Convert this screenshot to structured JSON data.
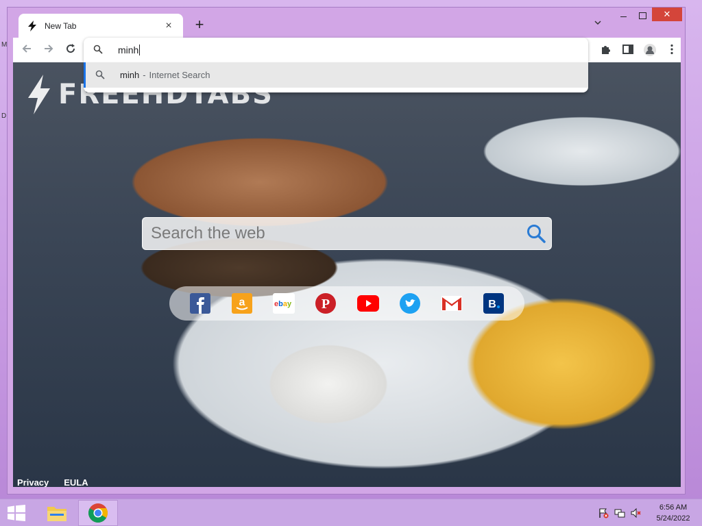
{
  "desktop": {
    "edge_glyphs": [
      "M",
      "D"
    ]
  },
  "browser": {
    "tab": {
      "title": "New Tab",
      "close_label": "×"
    },
    "new_tab_label": "+",
    "window_controls": {
      "close_label": "✕"
    },
    "omnibox": {
      "value": "minh"
    },
    "suggestion": {
      "query": "minh",
      "separator": "-",
      "engine": "Internet Search"
    }
  },
  "page": {
    "logo_text": "FREEHDTABS",
    "search": {
      "placeholder": "Search the web"
    },
    "quicklinks": [
      {
        "name": "facebook",
        "color": "#3b5998"
      },
      {
        "name": "amazon",
        "color": "#f7a21b"
      },
      {
        "name": "ebay",
        "color": "#e53238"
      },
      {
        "name": "pinterest",
        "color": "#cb2027"
      },
      {
        "name": "youtube",
        "color": "#ff0000"
      },
      {
        "name": "twitter",
        "color": "#1da1f2"
      },
      {
        "name": "gmail",
        "color": "#d93025"
      },
      {
        "name": "booking",
        "color": "#003580"
      }
    ],
    "footer": {
      "privacy": "Privacy",
      "eula": "EULA"
    }
  },
  "taskbar": {
    "clock": {
      "time": "6:56 AM",
      "date": "5/24/2022"
    }
  }
}
